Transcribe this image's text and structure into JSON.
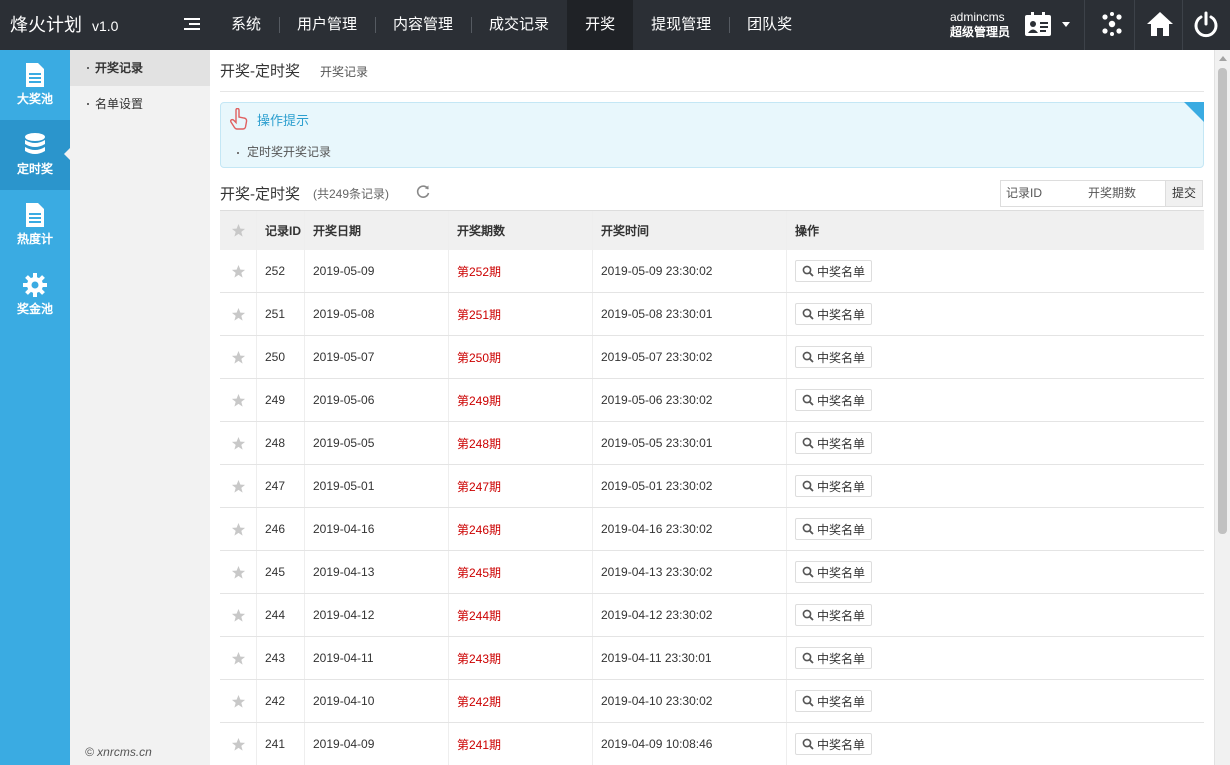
{
  "app": {
    "name": "烽火计划",
    "version": "v1.0"
  },
  "topnav": [
    {
      "label": "系统",
      "active": false
    },
    {
      "label": "用户管理",
      "active": false
    },
    {
      "label": "内容管理",
      "active": false
    },
    {
      "label": "成交记录",
      "active": false
    },
    {
      "label": "开奖",
      "active": true
    },
    {
      "label": "提现管理",
      "active": false
    },
    {
      "label": "团队奖",
      "active": false
    }
  ],
  "user": {
    "name": "admincms",
    "role": "超级管理员"
  },
  "sidebar_main": [
    {
      "label": "大奖池",
      "icon": "document-icon",
      "active": false
    },
    {
      "label": "定时奖",
      "icon": "database-icon",
      "active": true
    },
    {
      "label": "热度计",
      "icon": "document-icon",
      "active": false
    },
    {
      "label": "奖金池",
      "icon": "gear-icon",
      "active": false
    }
  ],
  "sidebar_sub": [
    {
      "label": "开奖记录",
      "active": true
    },
    {
      "label": "名单设置",
      "active": false
    }
  ],
  "copyright": "© xnrcms.cn",
  "page": {
    "title": "开奖-定时奖",
    "subtitle": "开奖记录"
  },
  "tips": {
    "title": "操作提示",
    "items": [
      "定时奖开奖记录"
    ]
  },
  "list": {
    "title": "开奖-定时奖",
    "count_text": "(共249条记录)"
  },
  "search": {
    "field1": "记录ID",
    "field2": "开奖期数",
    "submit": "提交"
  },
  "table": {
    "columns": [
      "记录ID",
      "开奖日期",
      "开奖期数",
      "开奖时间",
      "操作"
    ],
    "action_label": "中奖名单",
    "rows": [
      {
        "id": "252",
        "date": "2019-05-09",
        "period": "第252期",
        "time": "2019-05-09 23:30:02"
      },
      {
        "id": "251",
        "date": "2019-05-08",
        "period": "第251期",
        "time": "2019-05-08 23:30:01"
      },
      {
        "id": "250",
        "date": "2019-05-07",
        "period": "第250期",
        "time": "2019-05-07 23:30:02"
      },
      {
        "id": "249",
        "date": "2019-05-06",
        "period": "第249期",
        "time": "2019-05-06 23:30:02"
      },
      {
        "id": "248",
        "date": "2019-05-05",
        "period": "第248期",
        "time": "2019-05-05 23:30:01"
      },
      {
        "id": "247",
        "date": "2019-05-01",
        "period": "第247期",
        "time": "2019-05-01 23:30:02"
      },
      {
        "id": "246",
        "date": "2019-04-16",
        "period": "第246期",
        "time": "2019-04-16 23:30:02"
      },
      {
        "id": "245",
        "date": "2019-04-13",
        "period": "第245期",
        "time": "2019-04-13 23:30:02"
      },
      {
        "id": "244",
        "date": "2019-04-12",
        "period": "第244期",
        "time": "2019-04-12 23:30:02"
      },
      {
        "id": "243",
        "date": "2019-04-11",
        "period": "第243期",
        "time": "2019-04-11 23:30:01"
      },
      {
        "id": "242",
        "date": "2019-04-10",
        "period": "第242期",
        "time": "2019-04-10 23:30:02"
      },
      {
        "id": "241",
        "date": "2019-04-09",
        "period": "第241期",
        "time": "2019-04-09 10:08:46"
      }
    ]
  },
  "colors": {
    "topbar": "#2b2f35",
    "sidebar": "#3aabe2",
    "accent": "#2c9fcf",
    "period": "#cc0000"
  }
}
